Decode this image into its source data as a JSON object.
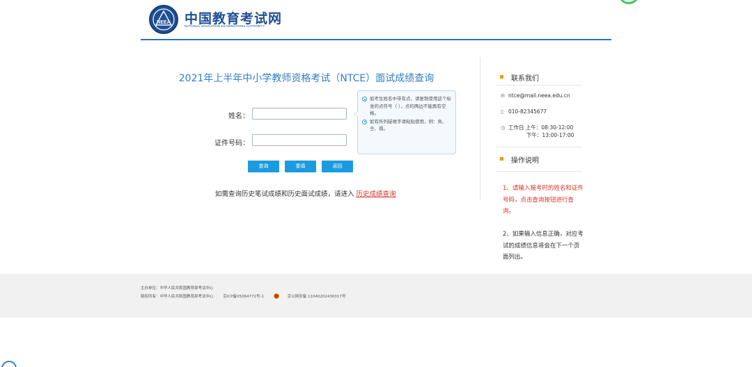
{
  "header": {
    "logo_cn": "中国教育考试网",
    "logo_en": "NATIONAL EDUCATION EXAMINATIONS AUTHORITY",
    "emblem_text": "NEEA",
    "brand_color": "#1f4f94"
  },
  "main": {
    "title": "2021年上半年中小学教师资格考试（NTCE）面试成绩查询",
    "name_label": "姓名：",
    "id_label": "证件号码：",
    "name_value": "",
    "id_value": "",
    "hints": [
      "如考生姓名中带有点，请复制使用这个标准的点符号（·），点的两边不能再有空格。",
      "如有所列疑难字请粘贴使用，例：奂、仝、璟。"
    ],
    "buttons": {
      "query": "查询",
      "reset": "重填",
      "back": "返回"
    },
    "history_text": "如需查询历史笔试成绩和历史面试成绩，请进入",
    "history_link": "历史成绩查询",
    "accent_color": "#2f7fc6",
    "button_color": "#1a9be0",
    "link_color": "#d8352a"
  },
  "sidebar": {
    "contact_title": "联系我们",
    "email": "ntce@mail.neea.edu.cn",
    "phone": "010-82345677",
    "hours_am": "工作日 上午：08:30-12:00",
    "hours_pm": "下午：13:00-17:00",
    "ops_title": "操作说明",
    "op1": "1、请输入报考时的姓名和证件号码，点击查询按钮进行查询。",
    "op2": "2、如果输入信息正确，对应考试的成绩信息将会在下一个页面列出。",
    "marker_color": "#f39800"
  },
  "footer": {
    "host": "主办单位：中华人民共和国教育部考试中心",
    "copyright": "版权所有：中华人民共和国教育部考试中心",
    "icp": "京ICP备05064772号-1",
    "police": "京公网安备 11040202430017号"
  }
}
